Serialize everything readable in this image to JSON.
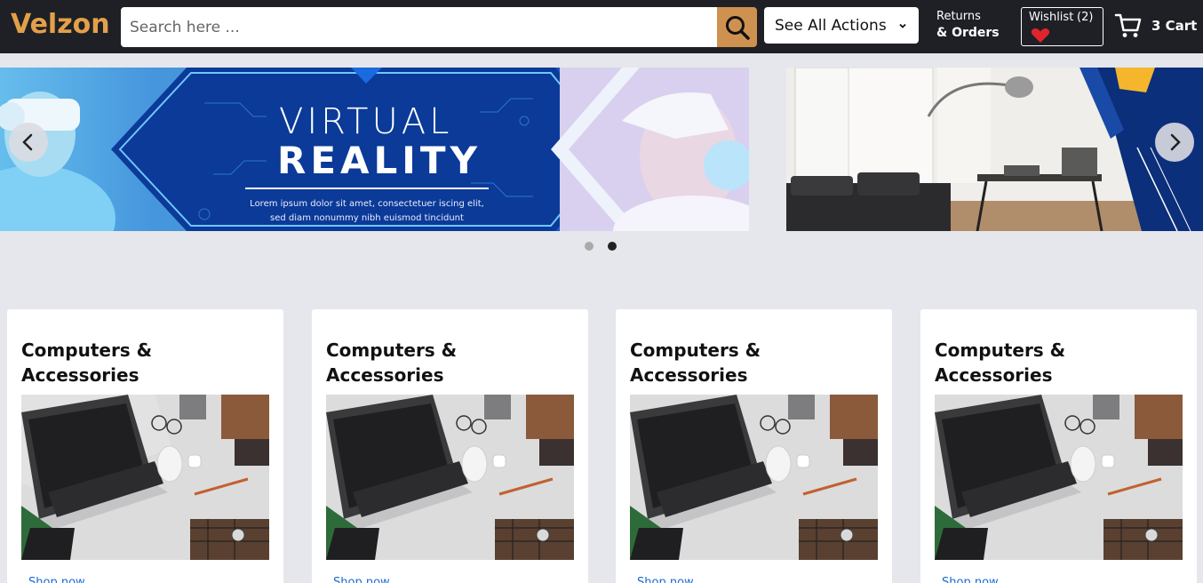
{
  "header": {
    "logo": "Velzon",
    "search_placeholder": "Search here ...",
    "actions_label": "See All Actions",
    "returns_line1": "Returns",
    "returns_line2": "& Orders",
    "wishlist_label": "Wishlist",
    "wishlist_count": "(2)",
    "cart_label": "3 Cart"
  },
  "carousel": {
    "slide1_title_line1": "VIRTUAL",
    "slide1_title_line2": "REALITY",
    "slide1_text": "Lorem ipsum dolor sit amet, consectetuer iscing elit, sed diam nonummy nibh euismod tincidunt",
    "dots": [
      "slide-1",
      "slide-2"
    ],
    "active_dot": 1
  },
  "cards": [
    {
      "title": "Computers & Accessories",
      "link": "Shop now"
    },
    {
      "title": "Computers & Accessories",
      "link": "Shop now"
    },
    {
      "title": "Computers & Accessories",
      "link": "Shop now"
    },
    {
      "title": "Computers & Accessories",
      "link": "Shop now"
    }
  ],
  "colors": {
    "header_bg": "#1e2026",
    "brand": "#e3a04a",
    "search_button": "#cf9150",
    "page_bg": "#e6e7ec",
    "link": "#1a6bd1",
    "heart": "#e0242b"
  },
  "icons": {
    "search": "search-icon",
    "actions_dropdown": "chevron-down-icon",
    "wishlist": "heart-icon",
    "cart": "cart-icon",
    "prev": "chevron-left-icon",
    "next": "chevron-right-icon"
  }
}
